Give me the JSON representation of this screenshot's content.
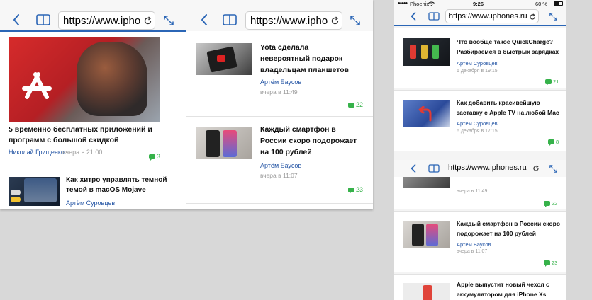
{
  "url": "https://www.iphones.ru/",
  "url_truncated": "https://www.iphon",
  "status_bar": {
    "carrier": "Phoenix",
    "time": "9:26",
    "battery": "60 %"
  },
  "colors": {
    "accent": "#2b66b6",
    "author": "#2354a4",
    "comments": "#36b24a"
  },
  "articles": {
    "apps_free": {
      "title": "5 временно бесплатных приложений и программ с большой скидкой",
      "author": "Николай Грищенко",
      "date": "вчера в 21:00",
      "comments": "3"
    },
    "dark_mojave": {
      "title": "Как хитро управлять темной темой в macOS Mojave",
      "author": "Артём Суровцев"
    },
    "yota": {
      "title": "Yota сделала невероятный подарок владельцам планшетов",
      "author": "Артём Баусов",
      "date": "вчера в 11:49",
      "comments": "22"
    },
    "smartphone_price": {
      "title": "Каждый смартфон в России скоро подорожает на 100 рублей",
      "title_short": "Каждый смартфон в России скоро подорожает на 100 рублей",
      "author": "Артём Баусов",
      "date": "вчера в 11:07",
      "comments": "23"
    },
    "quickcharge": {
      "title": "Что вообще такое QuickCharge? Разбираемся в быстрых зарядках",
      "author": "Артём Суровцев",
      "date": "6 декабря в 19:15",
      "comments": "21"
    },
    "appletv": {
      "title": "Как добавить красивейшую заставку с Apple TV на любой Mac",
      "author": "Артём Суровцев",
      "date": "6 декабря в 17:15",
      "comments": "8"
    },
    "case_xs": {
      "title": "Apple выпустит новый чехол с аккумулятором для iPhone Xs"
    }
  }
}
